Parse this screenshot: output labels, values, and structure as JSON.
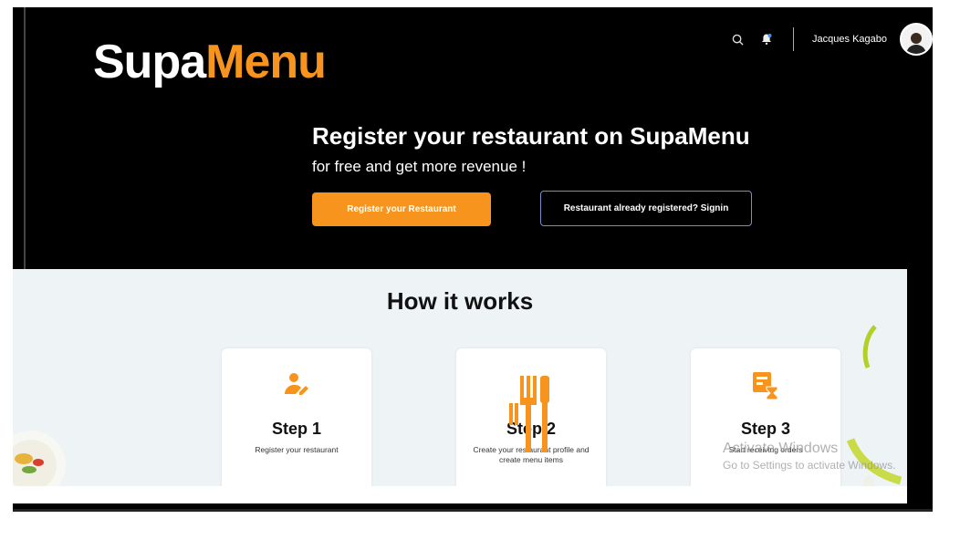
{
  "brand": {
    "part1": "Supa",
    "part2": "Menu"
  },
  "header": {
    "username": "Jacques Kagabo",
    "search_icon": "search-icon",
    "notification_icon": "bell-icon"
  },
  "hero": {
    "title": "Register your restaurant on SupaMenu",
    "subtitle": "for free and get more revenue !",
    "primary_button": "Register your Restaurant",
    "secondary_button": "Restaurant already registered? Signin"
  },
  "how": {
    "title": "How it works",
    "steps": [
      {
        "title": "Step 1",
        "description": "Register your restaurant",
        "icon": "user-edit-icon"
      },
      {
        "title": "Step 2",
        "description": "Create your restaurant profile and create menu items",
        "icon": "fork-knife-icon"
      },
      {
        "title": "Step 3",
        "description": "Start receiving orders",
        "icon": "calendar-hourglass-icon"
      }
    ]
  },
  "watermark": {
    "title": "Activate Windows",
    "subtitle": "Go to Settings to activate Windows."
  },
  "colors": {
    "accent": "#F7941D",
    "background": "#000000",
    "section_bg": "#eef3f6"
  }
}
